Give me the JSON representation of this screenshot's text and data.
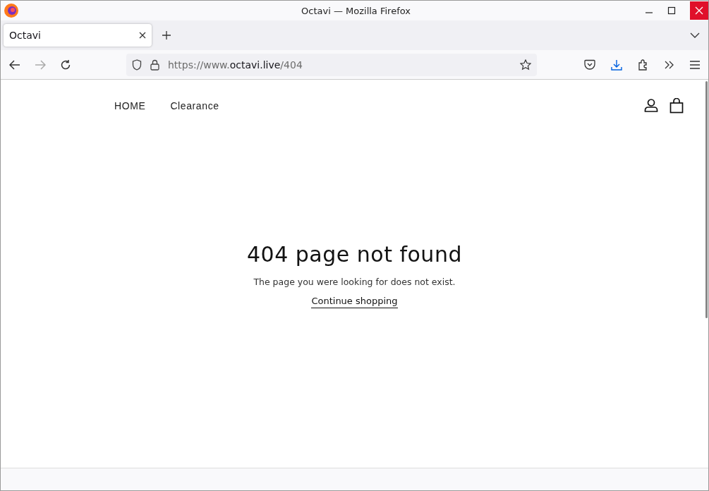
{
  "window": {
    "title": "Octavi — Mozilla Firefox"
  },
  "tabs": [
    {
      "label": "Octavi",
      "selected": true
    }
  ],
  "address_bar": {
    "url_scheme": "https://www.",
    "url_domain": "octavi.live",
    "url_path": "/404"
  },
  "site_nav": {
    "links": [
      "HOME",
      "Clearance"
    ]
  },
  "error": {
    "heading": "404 page not found",
    "message": "The page you were looking for does not exist.",
    "link": "Continue shopping"
  }
}
